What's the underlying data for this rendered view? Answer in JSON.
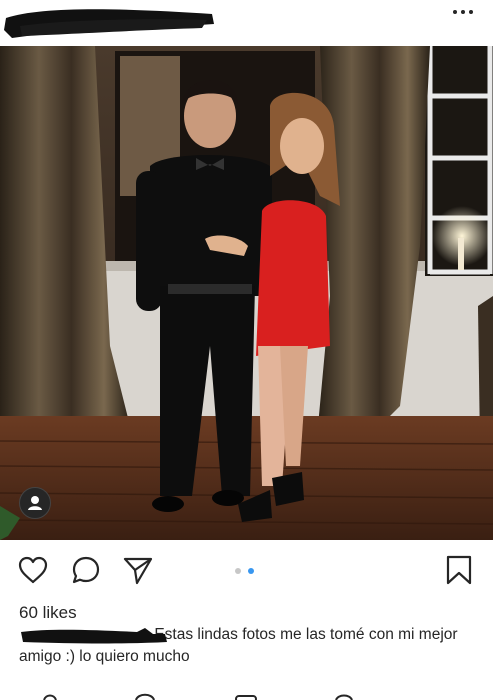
{
  "header": {
    "username": "",
    "more_icon": "more-horizontal-icon"
  },
  "post": {
    "image_description_icon": "photo",
    "profile_badge_icon": "person-icon",
    "carousel": {
      "count": 2,
      "active_index": 2
    },
    "actions": {
      "like_icon": "heart-icon",
      "comment_icon": "comment-icon",
      "share_icon": "paper-plane-icon",
      "save_icon": "bookmark-icon"
    },
    "likes_text": "60 likes",
    "caption": {
      "author": "",
      "text": "Estas lindas fotos me las tomé con mi mejor amigo :) lo quiero mucho"
    }
  },
  "colors": {
    "accent_blue": "#3897f0",
    "text": "#262626",
    "inactive_dot": "#c7c7c7"
  }
}
